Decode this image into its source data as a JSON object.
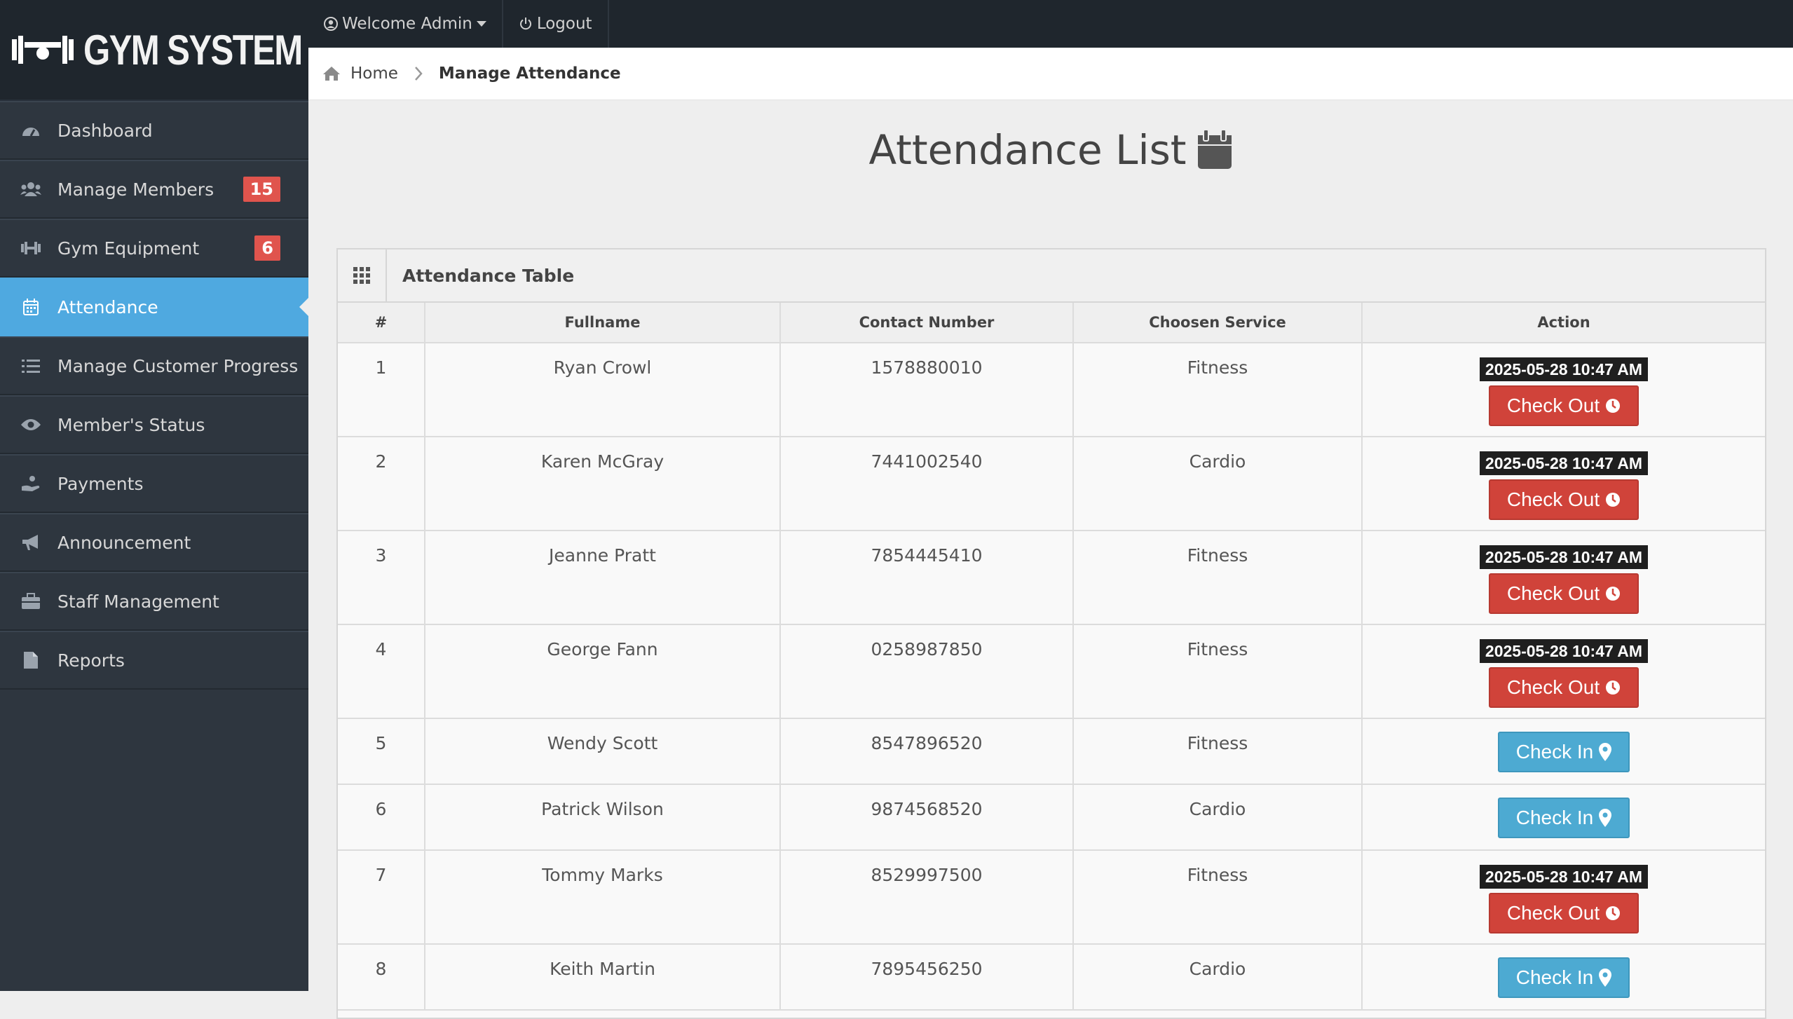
{
  "brand": {
    "logo_text": "GYM SYSTEM"
  },
  "topbar": {
    "welcome": "Welcome Admin",
    "logout": "Logout"
  },
  "breadcrumb": {
    "home": "Home",
    "current": "Manage Attendance"
  },
  "sidebar": {
    "items": [
      {
        "label": "Dashboard",
        "icon": "dashboard-icon",
        "badge": ""
      },
      {
        "label": "Manage Members",
        "icon": "users-icon",
        "badge": "15"
      },
      {
        "label": "Gym Equipment",
        "icon": "dumbbell-icon",
        "badge": "6"
      },
      {
        "label": "Attendance",
        "icon": "calendar-icon",
        "badge": "",
        "active": true
      },
      {
        "label": "Manage Customer Progress",
        "icon": "tasks-icon",
        "badge": ""
      },
      {
        "label": "Member's Status",
        "icon": "eye-icon",
        "badge": ""
      },
      {
        "label": "Payments",
        "icon": "hand-money-icon",
        "badge": ""
      },
      {
        "label": "Announcement",
        "icon": "megaphone-icon",
        "badge": ""
      },
      {
        "label": "Staff Management",
        "icon": "briefcase-icon",
        "badge": ""
      },
      {
        "label": "Reports",
        "icon": "file-icon",
        "badge": ""
      }
    ]
  },
  "main": {
    "title": "Attendance List",
    "panel_title": "Attendance Table",
    "columns": [
      "#",
      "Fullname",
      "Contact Number",
      "Choosen Service",
      "Action"
    ],
    "rows": [
      {
        "num": "1",
        "name": "Ryan Crowl",
        "contact": "1578880010",
        "service": "Fitness",
        "status": "out",
        "timestamp": "2025-05-28 10:47 AM",
        "button": "Check Out"
      },
      {
        "num": "2",
        "name": "Karen McGray",
        "contact": "7441002540",
        "service": "Cardio",
        "status": "out",
        "timestamp": "2025-05-28 10:47 AM",
        "button": "Check Out"
      },
      {
        "num": "3",
        "name": "Jeanne Pratt",
        "contact": "7854445410",
        "service": "Fitness",
        "status": "out",
        "timestamp": "2025-05-28 10:47 AM",
        "button": "Check Out"
      },
      {
        "num": "4",
        "name": "George Fann",
        "contact": "0258987850",
        "service": "Fitness",
        "status": "out",
        "timestamp": "2025-05-28 10:47 AM",
        "button": "Check Out"
      },
      {
        "num": "5",
        "name": "Wendy Scott",
        "contact": "8547896520",
        "service": "Fitness",
        "status": "in",
        "timestamp": "",
        "button": "Check In"
      },
      {
        "num": "6",
        "name": "Patrick Wilson",
        "contact": "9874568520",
        "service": "Cardio",
        "status": "in",
        "timestamp": "",
        "button": "Check In"
      },
      {
        "num": "7",
        "name": "Tommy Marks",
        "contact": "8529997500",
        "service": "Fitness",
        "status": "out",
        "timestamp": "2025-05-28 10:47 AM",
        "button": "Check Out"
      },
      {
        "num": "8",
        "name": "Keith Martin",
        "contact": "7895456250",
        "service": "Cardio",
        "status": "in",
        "timestamp": "",
        "button": "Check In"
      }
    ]
  },
  "colors": {
    "sidebar_bg": "#2e363f",
    "active_item": "#4fa9e0",
    "badge": "#e0544d",
    "check_out": "#d0433a",
    "check_in": "#4daad2"
  }
}
